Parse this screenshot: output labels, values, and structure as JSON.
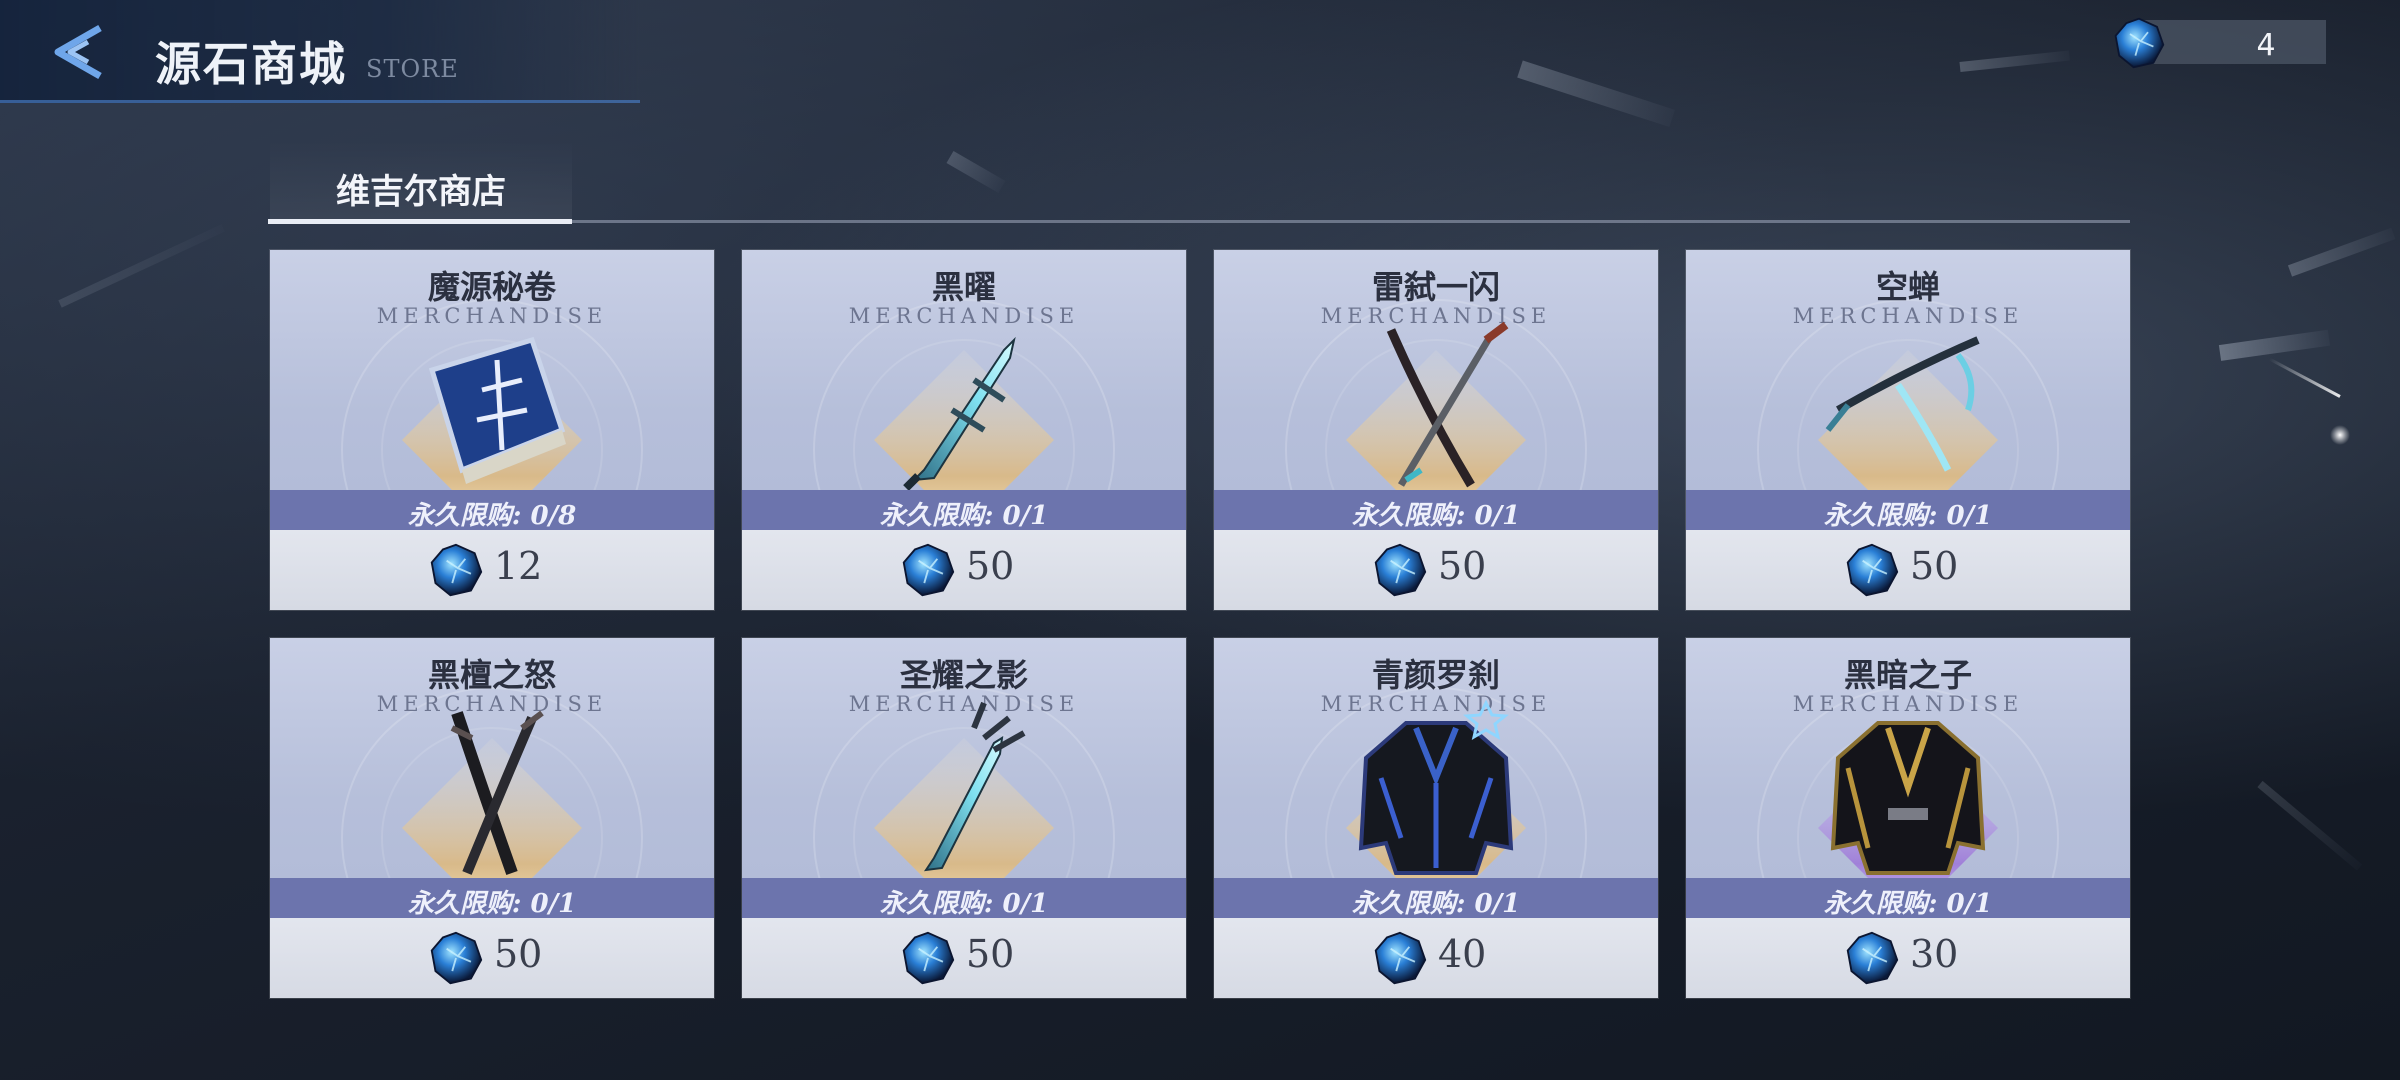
{
  "header": {
    "title": "源石商城",
    "subtitle": "STORE",
    "currency_amount": "4"
  },
  "tabs": [
    {
      "label": "维吉尔商店",
      "active": true
    }
  ],
  "colors": {
    "limit_bar": "#6c74ad",
    "card_bg": "#b6bfda",
    "accent_blue": "#4a7fc9"
  },
  "items": [
    {
      "name": "魔源秘卷",
      "tag": "MERCHANDISE",
      "limit": "永久限购: 0/8",
      "price": "12",
      "icon": "spell-tome-icon"
    },
    {
      "name": "黑曜",
      "tag": "MERCHANDISE",
      "limit": "永久限购: 0/1",
      "price": "50",
      "icon": "obsidian-sword-icon"
    },
    {
      "name": "雷弑一闪",
      "tag": "MERCHANDISE",
      "limit": "永久限购: 0/1",
      "price": "50",
      "icon": "twin-katana-icon"
    },
    {
      "name": "空蝉",
      "tag": "MERCHANDISE",
      "limit": "永久限购: 0/1",
      "price": "50",
      "icon": "scythe-blade-icon"
    },
    {
      "name": "黑檀之怒",
      "tag": "MERCHANDISE",
      "limit": "永久限购: 0/1",
      "price": "50",
      "icon": "ebony-blades-icon"
    },
    {
      "name": "圣耀之影",
      "tag": "MERCHANDISE",
      "limit": "永久限购: 0/1",
      "price": "50",
      "icon": "holy-sword-icon"
    },
    {
      "name": "青颜罗刹",
      "tag": "MERCHANDISE",
      "limit": "永久限购: 0/1",
      "price": "40",
      "icon": "blue-armor-coat-icon"
    },
    {
      "name": "黑暗之子",
      "tag": "MERCHANDISE",
      "limit": "永久限购: 0/1",
      "price": "30",
      "icon": "dark-gold-coat-icon"
    }
  ]
}
